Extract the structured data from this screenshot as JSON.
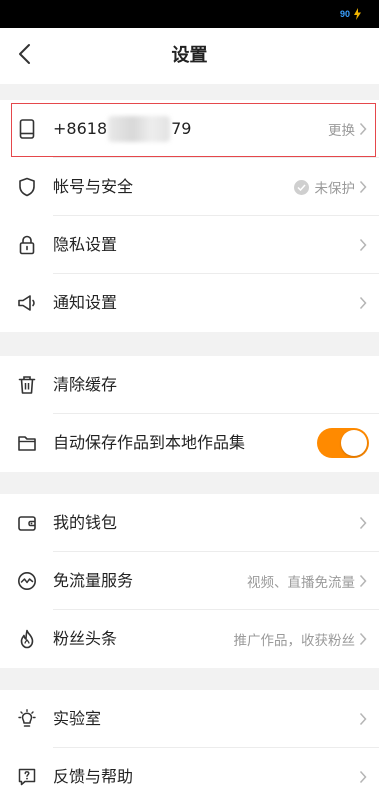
{
  "status_bar": {
    "battery_level": "90"
  },
  "header": {
    "title": "设置"
  },
  "phone_row": {
    "number_prefix": "+8618",
    "number_suffix": "79",
    "action_label": "更换"
  },
  "account_group": [
    {
      "label": "帐号与安全",
      "trail": "未保护",
      "icon": "shield-icon"
    },
    {
      "label": "隐私设置",
      "trail": "",
      "icon": "lock-icon"
    },
    {
      "label": "通知设置",
      "trail": "",
      "icon": "megaphone-icon"
    }
  ],
  "storage_group": {
    "clear_cache_label": "清除缓存",
    "auto_save_label": "自动保存作品到本地作品集",
    "auto_save_enabled": true
  },
  "service_group": [
    {
      "label": "我的钱包",
      "trail": "",
      "icon": "wallet-icon"
    },
    {
      "label": "免流量服务",
      "trail": "视频、直播免流量",
      "icon": "pulse-icon"
    },
    {
      "label": "粉丝头条",
      "trail": "推广作品，收获粉丝",
      "icon": "flame-icon"
    }
  ],
  "lab_group": [
    {
      "label": "实验室",
      "trail": "",
      "icon": "lightbulb-icon"
    },
    {
      "label": "反馈与帮助",
      "trail": "",
      "icon": "help-icon"
    }
  ],
  "colors": {
    "toggle_on": "#ff8a00",
    "highlight": "#e5474b",
    "background": "#f2f2f2"
  }
}
